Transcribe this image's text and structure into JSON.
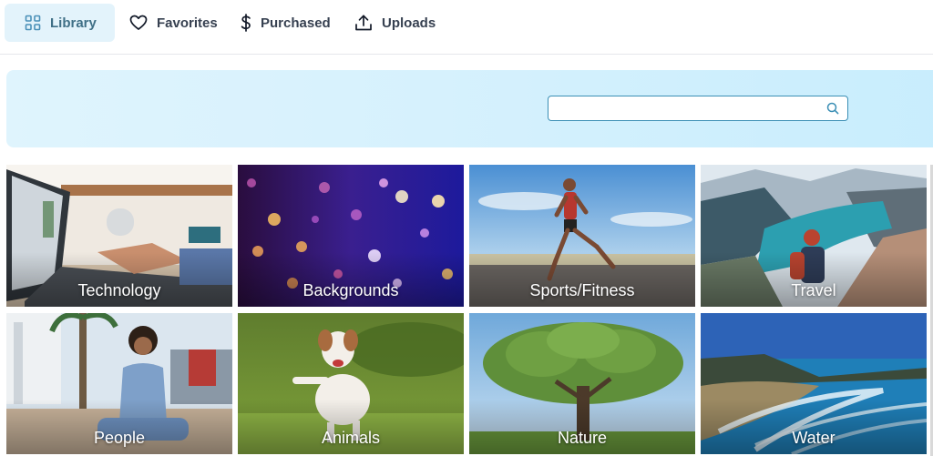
{
  "nav": {
    "tabs": [
      {
        "label": "Library",
        "icon": "grid-icon",
        "active": true
      },
      {
        "label": "Favorites",
        "icon": "heart-icon",
        "active": false
      },
      {
        "label": "Purchased",
        "icon": "dollar-icon",
        "active": false
      },
      {
        "label": "Uploads",
        "icon": "upload-icon",
        "active": false
      }
    ]
  },
  "search": {
    "value": "",
    "placeholder": ""
  },
  "categories": [
    {
      "label": "Technology"
    },
    {
      "label": "Backgrounds"
    },
    {
      "label": "Sports/Fitness"
    },
    {
      "label": "Travel"
    },
    {
      "label": "People"
    },
    {
      "label": "Animals"
    },
    {
      "label": "Nature"
    },
    {
      "label": "Water"
    }
  ],
  "colors": {
    "accent": "#3f6f86",
    "active_tab_bg": "#e3f3fb",
    "hero_bg": "#d6f1fd",
    "search_border": "#3b8fb5"
  }
}
